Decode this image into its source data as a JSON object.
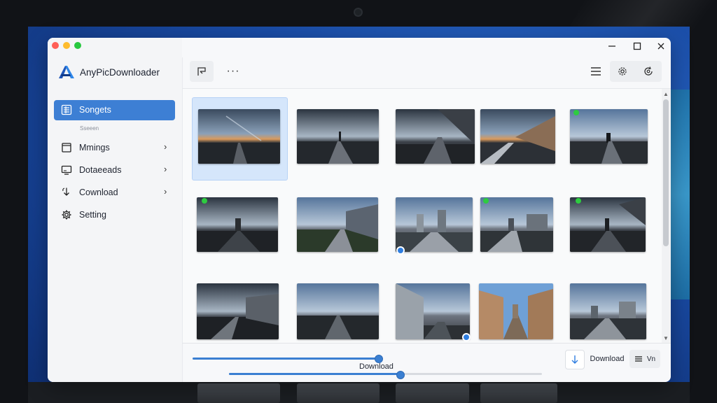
{
  "app": {
    "title": "AnyPicDownloader"
  },
  "sidebar": {
    "active": {
      "label": "Songets",
      "icon": "grid-list-icon"
    },
    "active_sub": "Sseeen",
    "items": [
      {
        "label": "Mmings",
        "icon": "window-icon"
      },
      {
        "label": "Dotaeeads",
        "icon": "monitor-icon"
      },
      {
        "label": "Cownload",
        "icon": "download-arrow-icon"
      },
      {
        "label": "Setting",
        "icon": "gear-icon"
      }
    ]
  },
  "toolbar": {
    "more": "···"
  },
  "bottom": {
    "download_center": "Download",
    "download_button": "Download",
    "vn_label": "Vn"
  },
  "colors": {
    "accent": "#3d7fd4",
    "window_bg": "#f7f8fa",
    "sidebar_bg": "#f4f5f7"
  }
}
